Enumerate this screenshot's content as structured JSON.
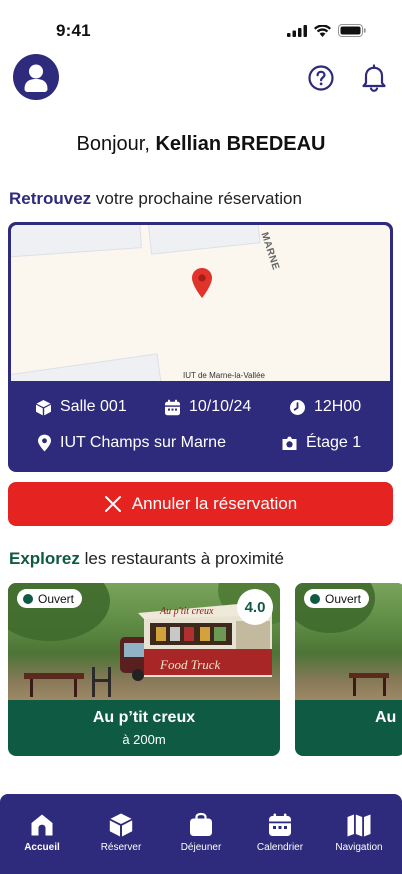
{
  "status_bar": {
    "time": "9:41"
  },
  "greeting": {
    "prefix": "Bonjour, ",
    "name": "Kellian BREDEAU"
  },
  "reservation_section": {
    "accent": "Retrouvez",
    "rest": " votre prochaine réservation"
  },
  "map": {
    "street_label": "MARNE",
    "place_label": "IUT de Marne-la-Vallée"
  },
  "reservation": {
    "room": "Salle 001",
    "date": "10/10/24",
    "time": "12H00",
    "location": "IUT Champs sur Marne",
    "floor": "Étage 1"
  },
  "cancel_button": {
    "label": "Annuler la réservation"
  },
  "restaurants_section": {
    "accent": "Explorez",
    "rest": " les restaurants à proximité"
  },
  "restaurants": [
    {
      "status": "Ouvert",
      "rating": "4.0",
      "name": "Au p’tit creux",
      "distance": "à 200m",
      "sign_text": "Au p'tit creux",
      "truck_text": "Food Truck"
    },
    {
      "status": "Ouvert",
      "name": "Au"
    }
  ],
  "bottom_nav": [
    {
      "label": "Accueil",
      "icon": "home-icon"
    },
    {
      "label": "Réserver",
      "icon": "cube-icon"
    },
    {
      "label": "Déjeuner",
      "icon": "bag-icon"
    },
    {
      "label": "Calendrier",
      "icon": "calendar-icon"
    },
    {
      "label": "Navigation",
      "icon": "map-icon"
    }
  ],
  "colors": {
    "primary": "#2e2a7c",
    "green": "#0f5a43",
    "danger": "#e52421"
  }
}
